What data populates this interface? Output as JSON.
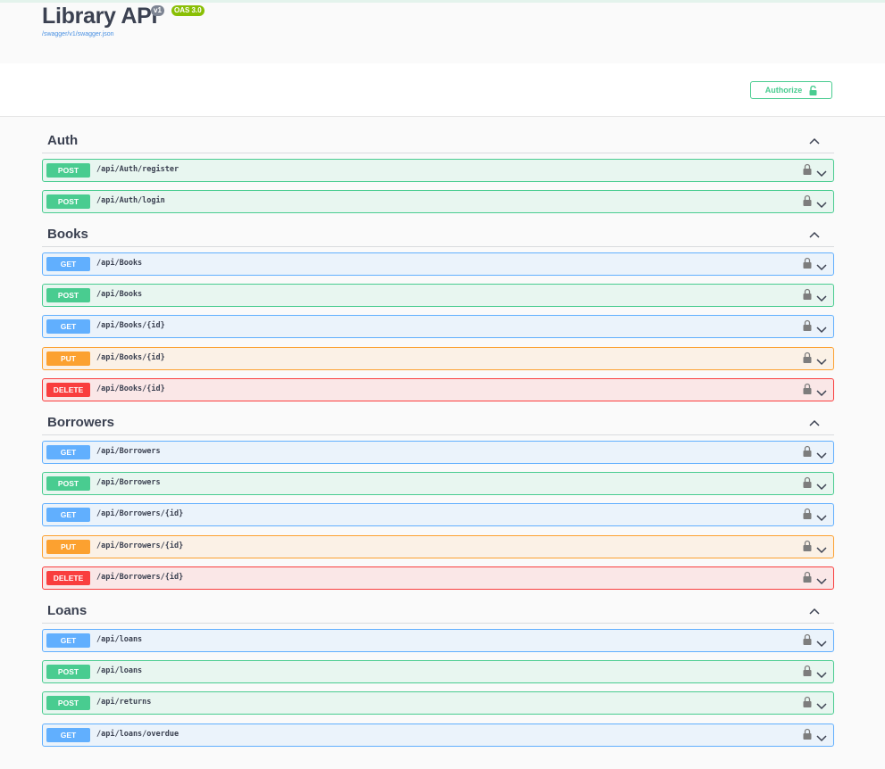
{
  "info": {
    "title": "Library API",
    "version_badge": "v1",
    "oas_badge": "OAS 3.0",
    "spec_link": "/swagger/v1/swagger.json"
  },
  "authorize": {
    "label": "Authorize",
    "icon": "unlock-icon"
  },
  "colors": {
    "post": "#49cc90",
    "get": "#61affe",
    "put": "#fca130",
    "delete": "#f93e3e"
  },
  "tags": [
    {
      "name": "Auth",
      "ops": [
        {
          "method": "POST",
          "path": "/api/Auth/register"
        },
        {
          "method": "POST",
          "path": "/api/Auth/login"
        }
      ]
    },
    {
      "name": "Books",
      "ops": [
        {
          "method": "GET",
          "path": "/api/Books"
        },
        {
          "method": "POST",
          "path": "/api/Books"
        },
        {
          "method": "GET",
          "path": "/api/Books/{id}"
        },
        {
          "method": "PUT",
          "path": "/api/Books/{id}"
        },
        {
          "method": "DELETE",
          "path": "/api/Books/{id}"
        }
      ]
    },
    {
      "name": "Borrowers",
      "ops": [
        {
          "method": "GET",
          "path": "/api/Borrowers"
        },
        {
          "method": "POST",
          "path": "/api/Borrowers"
        },
        {
          "method": "GET",
          "path": "/api/Borrowers/{id}"
        },
        {
          "method": "PUT",
          "path": "/api/Borrowers/{id}"
        },
        {
          "method": "DELETE",
          "path": "/api/Borrowers/{id}"
        }
      ]
    },
    {
      "name": "Loans",
      "ops": [
        {
          "method": "GET",
          "path": "/api/loans"
        },
        {
          "method": "POST",
          "path": "/api/loans"
        },
        {
          "method": "POST",
          "path": "/api/returns"
        },
        {
          "method": "GET",
          "path": "/api/loans/overdue"
        }
      ]
    }
  ]
}
